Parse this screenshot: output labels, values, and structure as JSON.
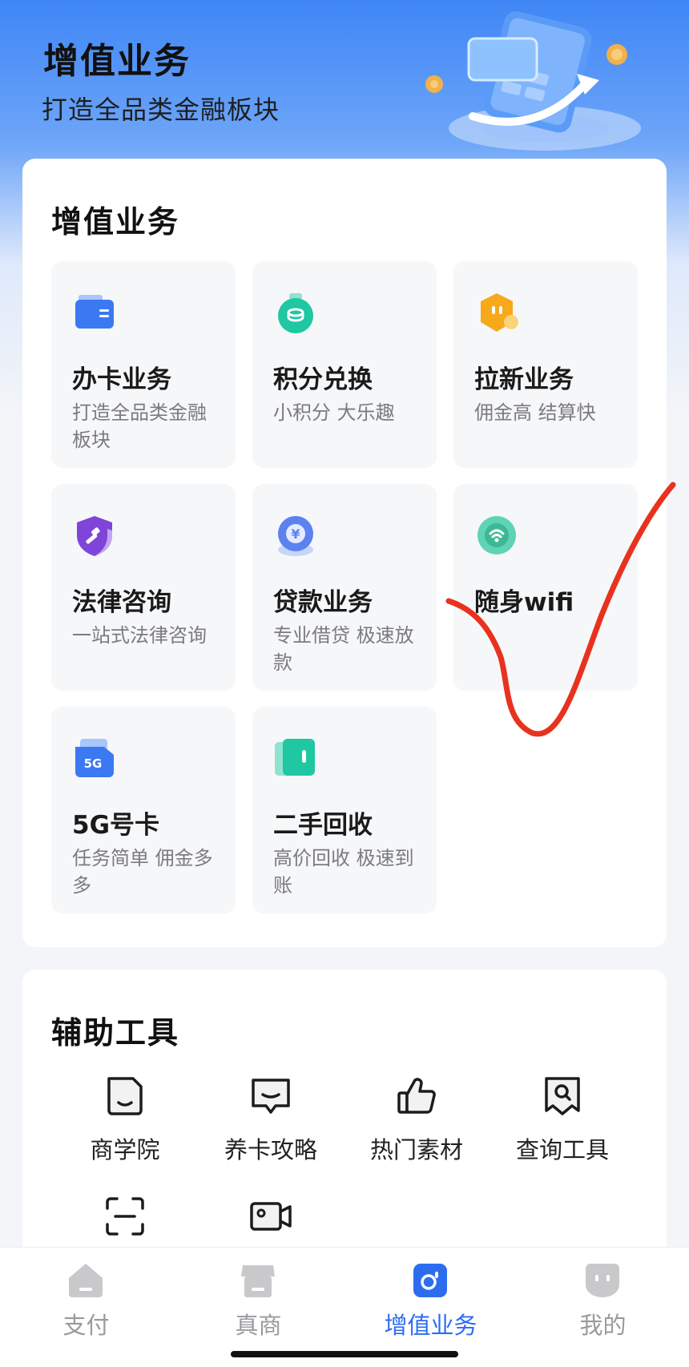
{
  "header": {
    "title": "增值业务",
    "subtitle": "打造全品类金融板块"
  },
  "services": {
    "title": "增值业务",
    "items": [
      {
        "name": "办卡业务",
        "desc": "打造全品类金融板块",
        "icon": "card-wallet-icon"
      },
      {
        "name": "积分兑换",
        "desc": "小积分 大乐趣",
        "icon": "points-coin-icon"
      },
      {
        "name": "拉新业务",
        "desc": "佣金高 结算快",
        "icon": "invite-icon"
      },
      {
        "name": "法律咨询",
        "desc": "一站式法律咨询",
        "icon": "legal-shield-icon"
      },
      {
        "name": "贷款业务",
        "desc": "专业借贷 极速放款",
        "icon": "loan-yen-icon"
      },
      {
        "name": "随身wifi",
        "desc": "",
        "icon": "wifi-icon"
      },
      {
        "name": "5G号卡",
        "desc": "任务简单 佣金多多",
        "icon": "5g-sim-icon"
      },
      {
        "name": "二手回收",
        "desc": "高价回收 极速到账",
        "icon": "recycle-icon"
      }
    ]
  },
  "tools": {
    "title": "辅助工具",
    "items": [
      {
        "label": "商学院",
        "icon": "business-school-icon"
      },
      {
        "label": "养卡攻略",
        "icon": "chat-guide-icon"
      },
      {
        "label": "热门素材",
        "icon": "thumbs-up-icon"
      },
      {
        "label": "查询工具",
        "icon": "search-doc-icon"
      },
      {
        "label": "",
        "icon": "scan-icon"
      },
      {
        "label": "",
        "icon": "video-icon"
      }
    ]
  },
  "tabbar": {
    "items": [
      {
        "label": "支付",
        "icon": "home-icon",
        "active": false
      },
      {
        "label": "真商",
        "icon": "shop-icon",
        "active": false
      },
      {
        "label": "增值业务",
        "icon": "value-added-icon",
        "active": true
      },
      {
        "label": "我的",
        "icon": "profile-icon",
        "active": false
      }
    ]
  },
  "colors": {
    "accent": "#2c6df0",
    "annotation": "#e8321f",
    "inactive": "#9a9a9e"
  }
}
